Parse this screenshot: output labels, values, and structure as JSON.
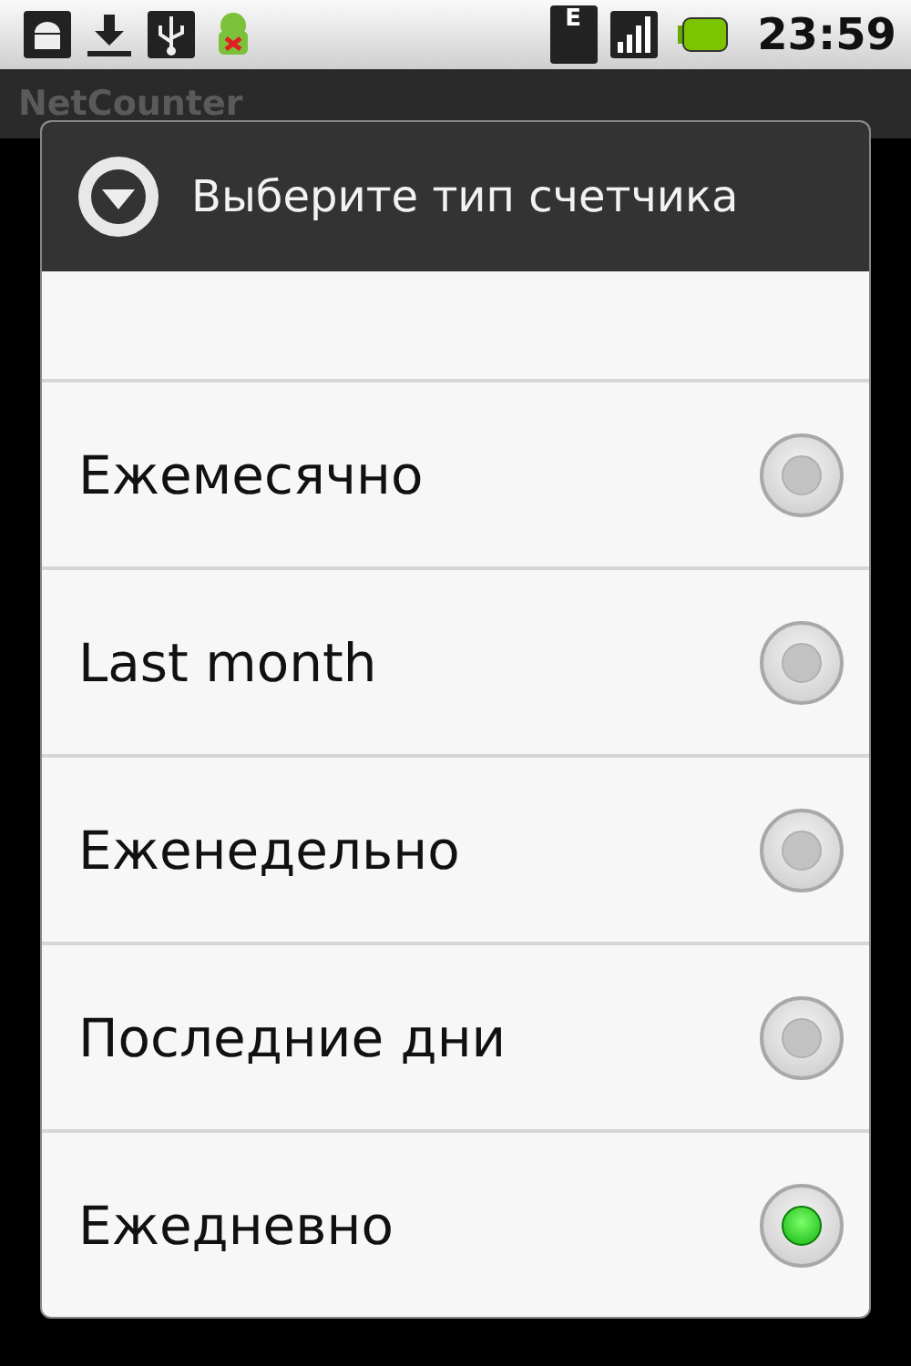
{
  "status_bar": {
    "network_type": "E",
    "time": "23:59"
  },
  "app": {
    "title": "NetCounter"
  },
  "dialog": {
    "title": "Выберите тип счетчика",
    "options": [
      {
        "label": "Ежемесячно",
        "selected": false
      },
      {
        "label": "Last month",
        "selected": false
      },
      {
        "label": "Еженедельно",
        "selected": false
      },
      {
        "label": "Последние дни",
        "selected": false
      },
      {
        "label": "Ежедневно",
        "selected": true
      }
    ]
  }
}
